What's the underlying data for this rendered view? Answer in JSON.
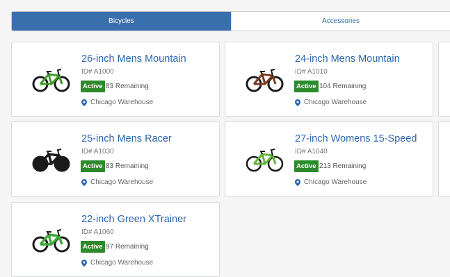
{
  "tabs": [
    {
      "label": "Bicycles"
    },
    {
      "label": "Accessories"
    }
  ],
  "status_label": "Active",
  "products": [
    {
      "title": "26-inch Mens Mountain",
      "id": "ID# A1000",
      "remaining": "83 Remaining",
      "location": "Chicago Warehouse",
      "frame_color": "#3f9b2a"
    },
    {
      "title": "24-inch Mens Mountain",
      "id": "ID# A1010",
      "remaining": "104 Remaining",
      "location": "Chicago Warehouse",
      "frame_color": "#7a3a1f"
    },
    {
      "title": "25-inch Mens Racer",
      "id": "ID# A1030",
      "remaining": "83 Remaining",
      "location": "Chicago Warehouse",
      "frame_color": "#1b1b1b"
    },
    {
      "title": "27-inch Womens 15-Speed",
      "id": "ID# A1040",
      "remaining": "213 Remaining",
      "location": "Chicago Warehouse",
      "frame_color": "#5fb435"
    },
    {
      "title": "22-inch Green XTrainer",
      "id": "ID# A1060",
      "remaining": "97 Remaining",
      "location": "Chicago Warehouse",
      "frame_color": "#3fa83a"
    }
  ]
}
